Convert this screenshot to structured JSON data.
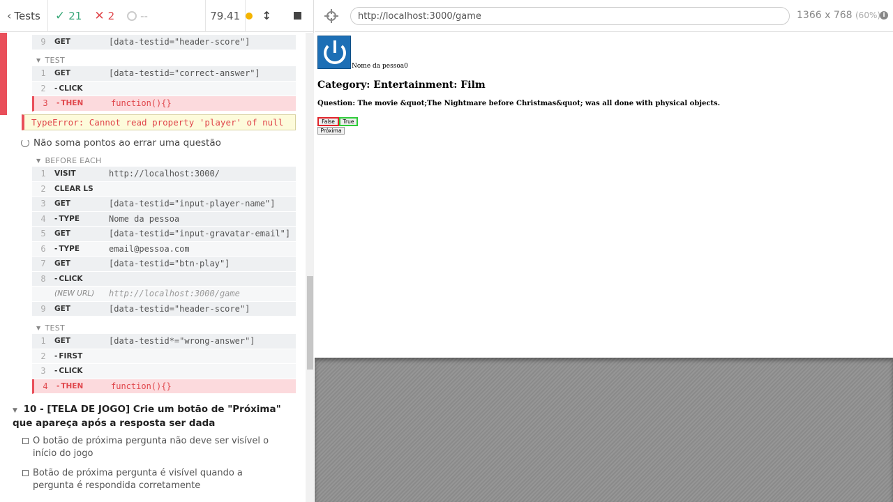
{
  "header": {
    "tests_label": "Tests",
    "passed": "21",
    "failed": "2",
    "pending": "--",
    "duration": "79.41"
  },
  "before_cmds_top": [
    {
      "num": "9",
      "name": "GET",
      "msg": "[data-testid=\"header-score\"]"
    }
  ],
  "test1_label": "TEST",
  "test1_cmds": [
    {
      "num": "1",
      "name": "GET",
      "msg": "[data-testid=\"correct-answer\"]"
    },
    {
      "num": "2",
      "name": "CLICK",
      "msg": ""
    },
    {
      "num": "3",
      "name": "THEN",
      "msg": "function(){}"
    }
  ],
  "error_message": "TypeError: Cannot read property 'player' of null",
  "running_test_title": "Não soma pontos ao errar uma questão",
  "before_each_label": "BEFORE EACH",
  "before_each_cmds": [
    {
      "num": "1",
      "name": "VISIT",
      "msg": "http://localhost:3000/"
    },
    {
      "num": "2",
      "name": "CLEAR LS",
      "msg": ""
    },
    {
      "num": "3",
      "name": "GET",
      "msg": "[data-testid=\"input-player-name\"]"
    },
    {
      "num": "4",
      "name": "TYPE",
      "msg": "Nome da pessoa"
    },
    {
      "num": "5",
      "name": "GET",
      "msg": "[data-testid=\"input-gravatar-email\"]"
    },
    {
      "num": "6",
      "name": "TYPE",
      "msg": "email@pessoa.com"
    },
    {
      "num": "7",
      "name": "GET",
      "msg": "[data-testid=\"btn-play\"]"
    },
    {
      "num": "8",
      "name": "CLICK",
      "msg": ""
    },
    {
      "num": "",
      "name": "(NEW URL)",
      "msg": "http://localhost:3000/game"
    },
    {
      "num": "9",
      "name": "GET",
      "msg": "[data-testid=\"header-score\"]"
    }
  ],
  "test2_label": "TEST",
  "test2_cmds": [
    {
      "num": "1",
      "name": "GET",
      "msg": "[data-testid*=\"wrong-answer\"]"
    },
    {
      "num": "2",
      "name": "FIRST",
      "msg": ""
    },
    {
      "num": "3",
      "name": "CLICK",
      "msg": ""
    },
    {
      "num": "4",
      "name": "THEN",
      "msg": "function(){}"
    }
  ],
  "suite_title": "10 - [TELA DE JOGO] Crie um botão de \"Próxima\" que apareça após a resposta ser dada",
  "pending_tests": [
    "O botão de próxima pergunta não deve ser visível o início do jogo",
    "Botão de próxima pergunta é visível quando a pergunta é respondida corretamente"
  ],
  "aut": {
    "url": "http://localhost:3000/game",
    "viewport": "1366 x 768",
    "scale": "(60%)",
    "player_name": "Nome da pessoa0",
    "category": "Category: Entertainment: Film",
    "question": "Question: The movie &quot;The Nightmare before Christmas&quot; was all done with physical objects.",
    "answer_false": "False",
    "answer_true": "True",
    "next_button": "Próxima"
  },
  "colors": {
    "pass": "#3aa77a",
    "fail": "#e0474c",
    "fail_bar": "#e94f5a",
    "pending_dot": "#f4b400",
    "avatar": "#1d6fb5"
  }
}
